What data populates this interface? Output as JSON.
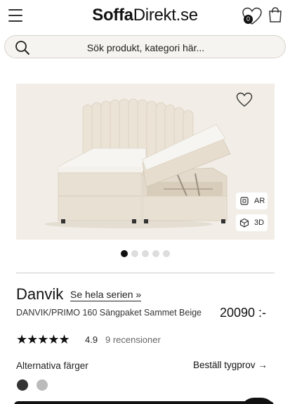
{
  "header": {
    "logo_bold": "Soffa",
    "logo_regular": "Direkt.se",
    "wishlist_count": "0"
  },
  "search": {
    "placeholder": "Sök produkt, kategori här..."
  },
  "gallery": {
    "ar_label": "AR",
    "d3_label": "3D",
    "image_count": 5,
    "active_index": 0
  },
  "product": {
    "name": "Danvik",
    "series_link": "Se hela serien »",
    "description": "DANVIK/PRIMO 160 Sängpaket Sammet Beige",
    "price": "20090 :-",
    "stars": "★★★★★",
    "rating": "4.9",
    "reviews": "9 recensioner"
  },
  "options": {
    "alt_colors_label": "Alternativa färger",
    "fabric_sample_link": "Beställ tygprov →",
    "swatches": [
      "#333333",
      "#bbbbbb"
    ]
  },
  "colors": {
    "accent": "#111111",
    "background": "#ffffff",
    "gallery_bg": "#f2eee7"
  }
}
